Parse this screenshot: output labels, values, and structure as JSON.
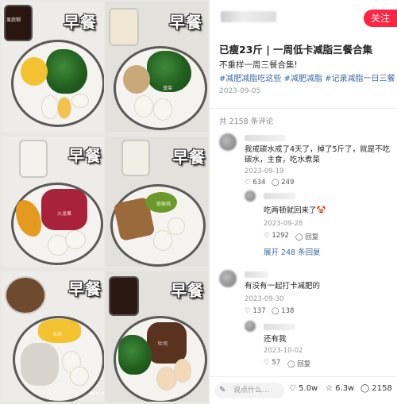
{
  "grid": {
    "badge_label": "早餐",
    "watermarks": [
      "果蔬糊",
      "水果",
      "火龙果",
      "猕猴桃",
      "菠菜",
      "玉米",
      "吐司"
    ]
  },
  "header": {
    "follow_label": "关注"
  },
  "post": {
    "title": "已瘦23斤 | 一周低卡减脂三餐合集",
    "description": "不重样一周三餐合集!",
    "tags": "#减肥减脂吃这些 #减肥减脂 #记录减脂一日三餐",
    "date": "2023-09-05"
  },
  "comments_count": "共 2158 条评论",
  "comments": [
    {
      "text": "我戒碳水戒了4天了，掉了5斤了，就是不吃碳水，主食，吃水煮菜",
      "date": "2023-09-19",
      "likes": "634",
      "replies": "249",
      "reply": {
        "text": "吃两顿就回来了🤡",
        "date": "2023-09-28",
        "likes": "1292",
        "reply_label": "回复"
      },
      "expand": "展开 248 条回复"
    },
    {
      "text": "有没有一起打卡减肥的",
      "date": "2023-09-30",
      "likes": "137",
      "replies": "138",
      "reply": {
        "text": "还有我",
        "date": "2023-10-02",
        "likes": "57",
        "reply_label": "回复"
      }
    }
  ],
  "bottom_bar": {
    "input_placeholder": "说点什么...",
    "like_count": "5.0w",
    "collect_count": "6.3w",
    "comment_count": "2158"
  },
  "colors": {
    "accent": "#ff2442",
    "tag_blue": "#3a6aa3"
  }
}
